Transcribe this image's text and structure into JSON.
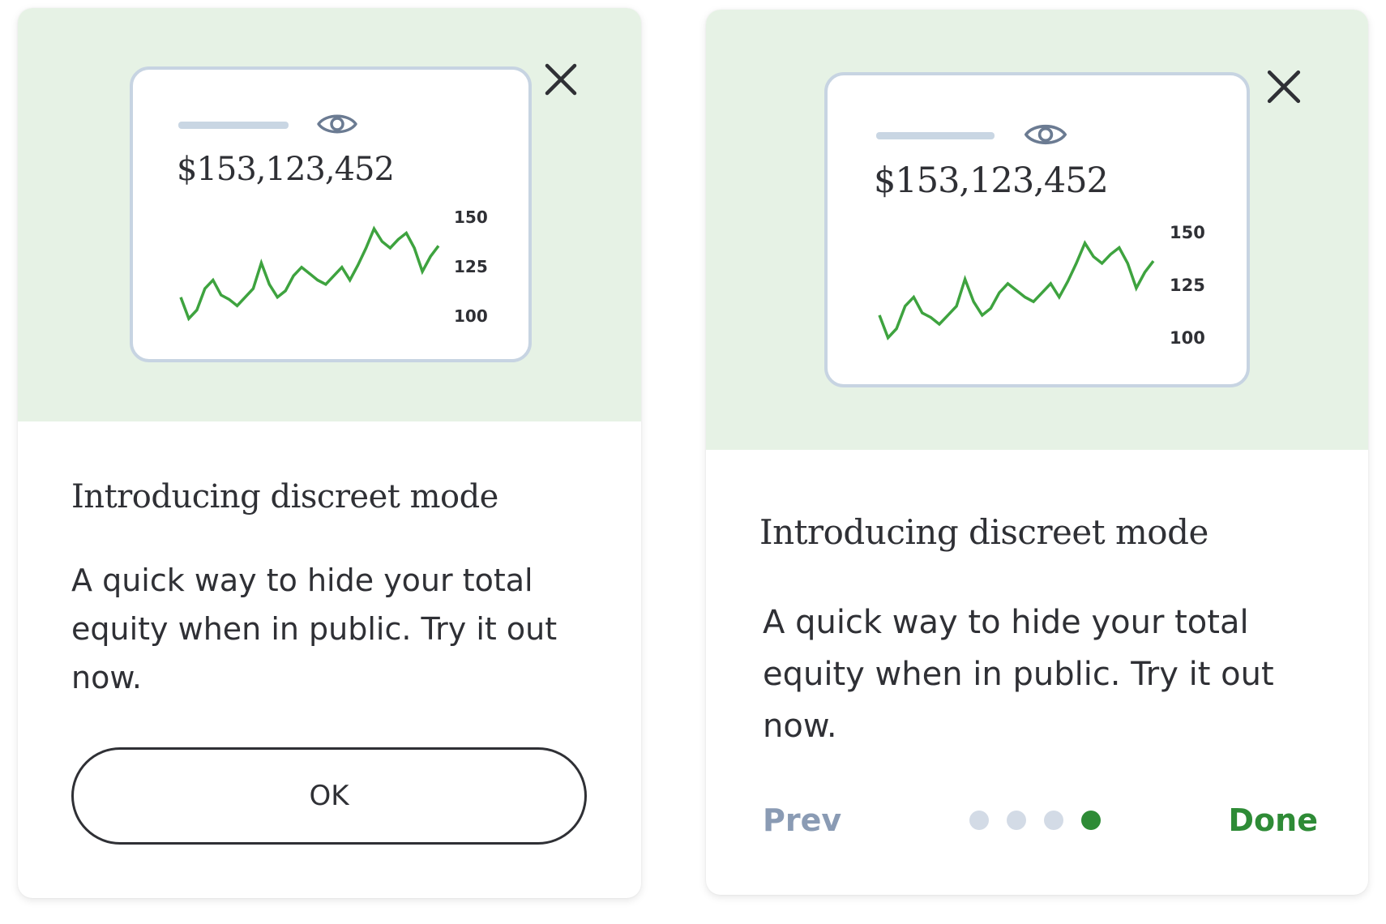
{
  "colors": {
    "hero_background": "#e6f2e5",
    "preview_border": "#c7d4e2",
    "text": "#2f3035",
    "accent_green": "#2e8b36",
    "muted_link": "#8a9bb4",
    "dot_inactive": "#d3dbe6"
  },
  "preview": {
    "amount": "$153,123,452",
    "icon": "eye-icon",
    "y_ticks": [
      "150",
      "125",
      "100"
    ],
    "sparkline_values": [
      113,
      103,
      107,
      117,
      121,
      114,
      112,
      109,
      113,
      117,
      129,
      119,
      113,
      116,
      123,
      127,
      124,
      121,
      119,
      123,
      127,
      121,
      128,
      136,
      145,
      139,
      136,
      140,
      143,
      136,
      125,
      132,
      137
    ],
    "sparkline_range": [
      100,
      150
    ]
  },
  "card_a": {
    "title": "Introducing discreet mode",
    "body": "A quick way to hide your total equity when in public. Try it out now.",
    "close_icon": "close-icon",
    "ok_label": "OK"
  },
  "card_b": {
    "title": "Introducing discreet mode",
    "body": "A quick way to hide your total equity when in public. Try it out now.",
    "close_icon": "close-icon",
    "prev_label": "Prev",
    "done_label": "Done",
    "pagination": {
      "total": 4,
      "active": 4
    }
  }
}
